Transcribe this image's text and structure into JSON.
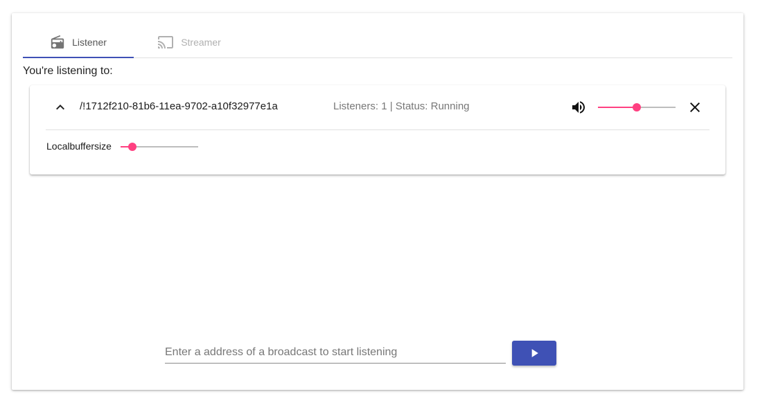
{
  "tabs": [
    {
      "label": "Listener",
      "icon": "radio-icon",
      "active": true
    },
    {
      "label": "Streamer",
      "icon": "cast-icon",
      "active": false
    }
  ],
  "colors": {
    "primary": "#3f51b5",
    "accent": "#ff4081"
  },
  "main": {
    "listening_label": "You're listening to:"
  },
  "stream": {
    "address": "/!1712f210-81b6-11ea-9702-a10f32977e1a",
    "info": "Listeners: 1 | Status: Running",
    "volume_level": 0.5,
    "buffer_label": "Localbuffersize",
    "buffer_level": 0.15
  },
  "connect": {
    "placeholder": "Enter a address of a broadcast to start listening"
  }
}
